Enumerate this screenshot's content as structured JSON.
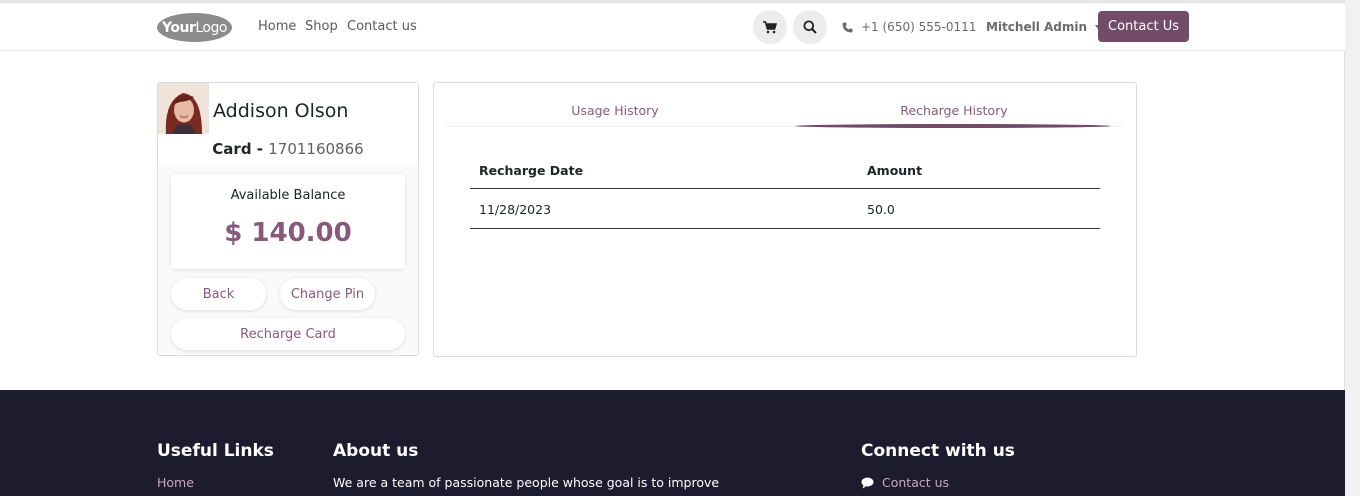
{
  "header": {
    "logo": {
      "bold": "Your",
      "light": "Logo"
    },
    "nav": [
      "Home",
      "Shop",
      "Contact us"
    ],
    "phone": "+1 (650) 555-0111",
    "user": "Mitchell Admin",
    "contact_button": "Contact Us"
  },
  "profile": {
    "name": "Addison Olson",
    "card_prefix": "Card -",
    "card_number": "1701160866",
    "balance_label": "Available Balance",
    "balance_value": "$ 140.00",
    "buttons": {
      "back": "Back",
      "change_pin": "Change Pin",
      "recharge": "Recharge Card"
    }
  },
  "tabs": {
    "usage": "Usage History",
    "recharge": "Recharge History",
    "active": "Recharge History"
  },
  "table": {
    "headers": [
      "Recharge Date",
      "Amount"
    ],
    "rows": [
      [
        "11/28/2023",
        "50.0"
      ]
    ]
  },
  "footer": {
    "useful_links": "Useful Links",
    "link_home": "Home",
    "about": "About us",
    "about_text": "We are a team of passionate people whose goal is to improve",
    "connect": "Connect with us",
    "connect_contact": "Contact us"
  },
  "colors": {
    "brand": "#714b67",
    "accent": "#875a7b",
    "footer_bg": "#1d1b2e"
  },
  "icons": [
    "cart-icon",
    "search-icon",
    "phone-icon",
    "comment-icon"
  ]
}
